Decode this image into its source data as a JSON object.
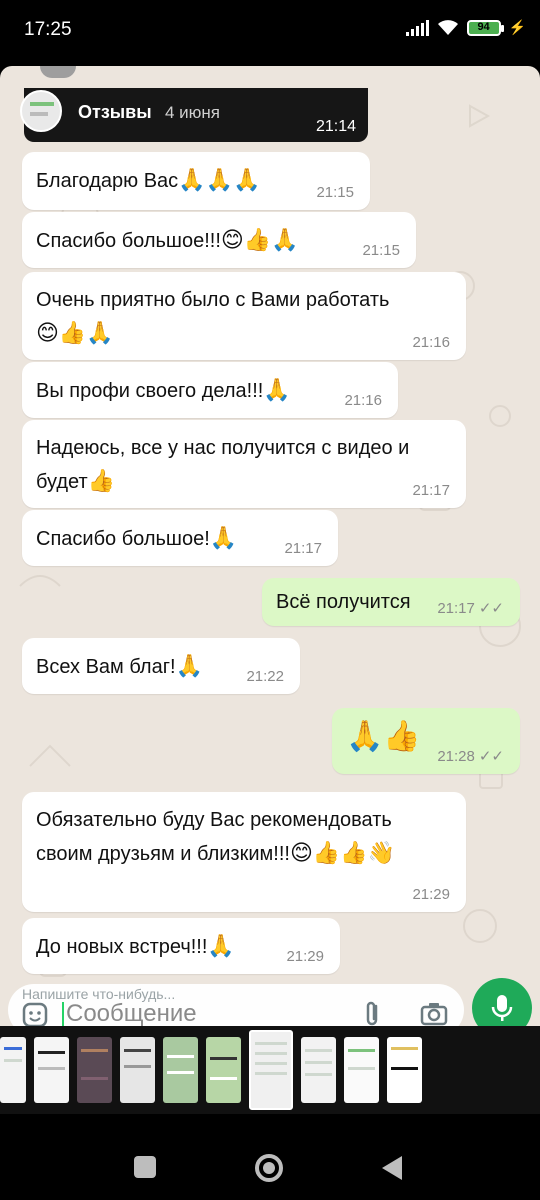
{
  "status_bar": {
    "time": "17:25",
    "battery": "94"
  },
  "forwarded": {
    "title": "Отзывы",
    "date": "4 июня",
    "time": "21:14"
  },
  "messages": [
    {
      "dir": "in",
      "text": "Благодарю Вас",
      "emoji": "🙏🙏🙏",
      "time": "21:15"
    },
    {
      "dir": "in",
      "text": "Спасибо большое!!!",
      "emoji": "😊👍🙏",
      "time": "21:15"
    },
    {
      "dir": "in",
      "text": "Очень приятно было с Вами работать",
      "emoji": "😊👍🙏",
      "time": "21:16"
    },
    {
      "dir": "in",
      "text": "Вы профи своего дела!!!",
      "emoji": "🙏",
      "time": "21:16"
    },
    {
      "dir": "in",
      "text": "Надеюсь, все у нас получится с видео и будет",
      "emoji": "👍",
      "time": "21:17"
    },
    {
      "dir": "in",
      "text": "Спасибо большое!",
      "emoji": "🙏",
      "time": "21:17"
    },
    {
      "dir": "out",
      "text": "Всё получится",
      "emoji": "",
      "time": "21:17"
    },
    {
      "dir": "in",
      "text": "Всех Вам благ!",
      "emoji": "🙏",
      "time": "21:22"
    },
    {
      "dir": "out",
      "text": "",
      "emoji": "🙏👍",
      "time": "21:28"
    },
    {
      "dir": "in",
      "text": "Обязательно буду Вас рекомендовать своим друзьям и близким!!!",
      "emoji": "😊👍👍👋",
      "time": "21:29"
    },
    {
      "dir": "in",
      "text": "До новых встреч!!!",
      "emoji": "🙏",
      "time": "21:29"
    }
  ],
  "input": {
    "hint": "Напишите что-нибудь...",
    "placeholder": "Сообщение"
  },
  "icons": {
    "sticker": "sticker-icon",
    "attach": "paperclip-icon",
    "camera": "camera-icon",
    "mic": "microphone-icon",
    "nav_recent": "square-icon",
    "nav_home": "home-icon",
    "nav_back": "back-icon"
  },
  "colors": {
    "incoming": "#ffffff",
    "outgoing": "#dcf8c6",
    "accent": "#1faa59",
    "wallpaper": "#ece5dd"
  }
}
